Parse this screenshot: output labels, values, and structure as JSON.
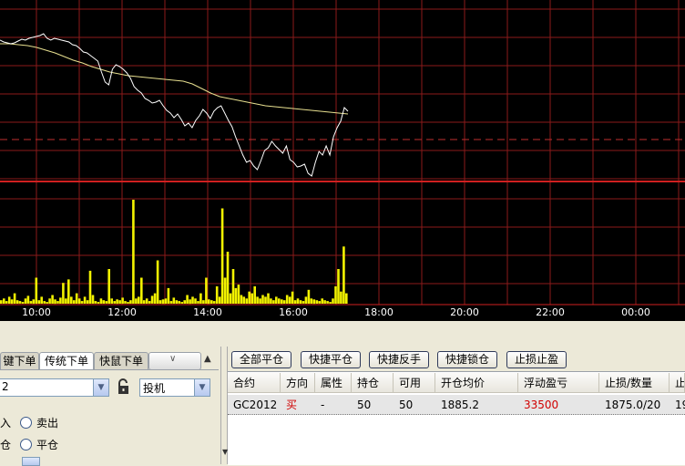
{
  "chart": {
    "time_labels": [
      "10:00",
      "12:00",
      "14:00",
      "16:00",
      "18:00",
      "20:00",
      "22:00",
      "00:00"
    ],
    "colors": {
      "background": "#000000",
      "grid": "#8b1a1a",
      "price_line": "#ffffff",
      "avg_line": "#e8e090",
      "volume": "#f2f200",
      "dashed_ref": "#c03030"
    },
    "price_series": [
      44,
      46,
      47,
      48,
      47,
      45,
      43,
      44,
      42,
      41,
      40,
      39,
      37,
      42,
      44,
      42,
      43,
      44,
      45,
      46,
      49,
      50,
      53,
      57,
      58,
      61,
      64,
      67,
      79,
      90,
      93,
      76,
      71,
      73,
      76,
      80,
      86,
      95,
      99,
      102,
      108,
      110,
      113,
      112,
      110,
      116,
      121,
      124,
      129,
      125,
      131,
      138,
      135,
      140,
      132,
      127,
      120,
      124,
      130,
      122,
      118,
      116,
      124,
      132,
      139,
      150,
      160,
      170,
      178,
      176,
      182,
      186,
      176,
      165,
      162,
      155,
      160,
      164,
      168,
      160,
      175,
      178,
      183,
      182,
      180,
      190,
      193,
      178,
      166,
      170,
      160,
      170,
      150,
      140,
      133,
      118,
      122
    ],
    "avg_series": [
      48,
      48,
      49,
      50,
      52,
      55,
      58,
      62,
      66,
      69,
      73,
      76,
      79,
      81,
      83,
      84,
      85,
      86,
      87,
      88,
      89,
      92,
      97,
      102,
      106,
      108,
      110,
      112,
      114,
      116,
      117,
      118,
      119,
      120,
      121,
      122,
      123,
      124,
      125
    ],
    "volume_series": [
      4,
      6,
      3,
      8,
      5,
      12,
      4,
      3,
      2,
      6,
      9,
      3,
      5,
      30,
      4,
      8,
      3,
      2,
      6,
      10,
      5,
      3,
      7,
      24,
      6,
      28,
      8,
      4,
      12,
      6,
      3,
      8,
      4,
      38,
      10,
      3,
      2,
      6,
      4,
      3,
      40,
      6,
      3,
      5,
      4,
      7,
      3,
      2,
      4,
      120,
      6,
      8,
      30,
      4,
      6,
      3,
      9,
      12,
      50,
      4,
      5,
      6,
      18,
      3,
      7,
      4,
      3,
      2,
      4,
      10,
      5,
      8,
      6,
      3,
      12,
      4,
      30,
      5,
      4,
      3,
      20,
      8,
      110,
      30,
      60,
      12,
      40,
      18,
      22,
      10,
      8,
      6,
      14,
      12,
      20,
      8,
      6,
      10,
      8,
      12,
      6,
      4,
      8,
      6,
      5,
      4,
      10,
      8,
      14,
      4,
      6,
      4,
      3,
      8,
      16,
      6,
      5,
      4,
      3,
      6,
      4,
      3,
      2,
      6,
      20,
      40,
      14,
      66,
      12
    ]
  },
  "order_panel": {
    "tabs": [
      "键下单",
      "传统下单",
      "快鼠下单"
    ],
    "contract_value": "2",
    "hedge_value": "投机",
    "radio_options": [
      "卖出",
      "平仓"
    ],
    "left_labels": [
      "入",
      "仓"
    ]
  },
  "positions_panel": {
    "toolbar": [
      "全部平仓",
      "快捷平仓",
      "快捷反手",
      "快捷锁仓",
      "止损止盈"
    ],
    "headers": [
      "合约",
      "方向",
      "属性",
      "持仓",
      "可用",
      "开仓均价",
      "浮动盈亏",
      "止损/数量",
      "止"
    ],
    "rows": [
      {
        "contract": "GC2012",
        "direction": "买",
        "attribute": "-",
        "position": "50",
        "available": "50",
        "avg_price": "1885.2",
        "float_pnl": "33500",
        "stop_qty": "1875.0/20",
        "extra": "19"
      }
    ],
    "colors": {
      "direction": "#d00000",
      "float_pnl": "#d00000"
    }
  }
}
